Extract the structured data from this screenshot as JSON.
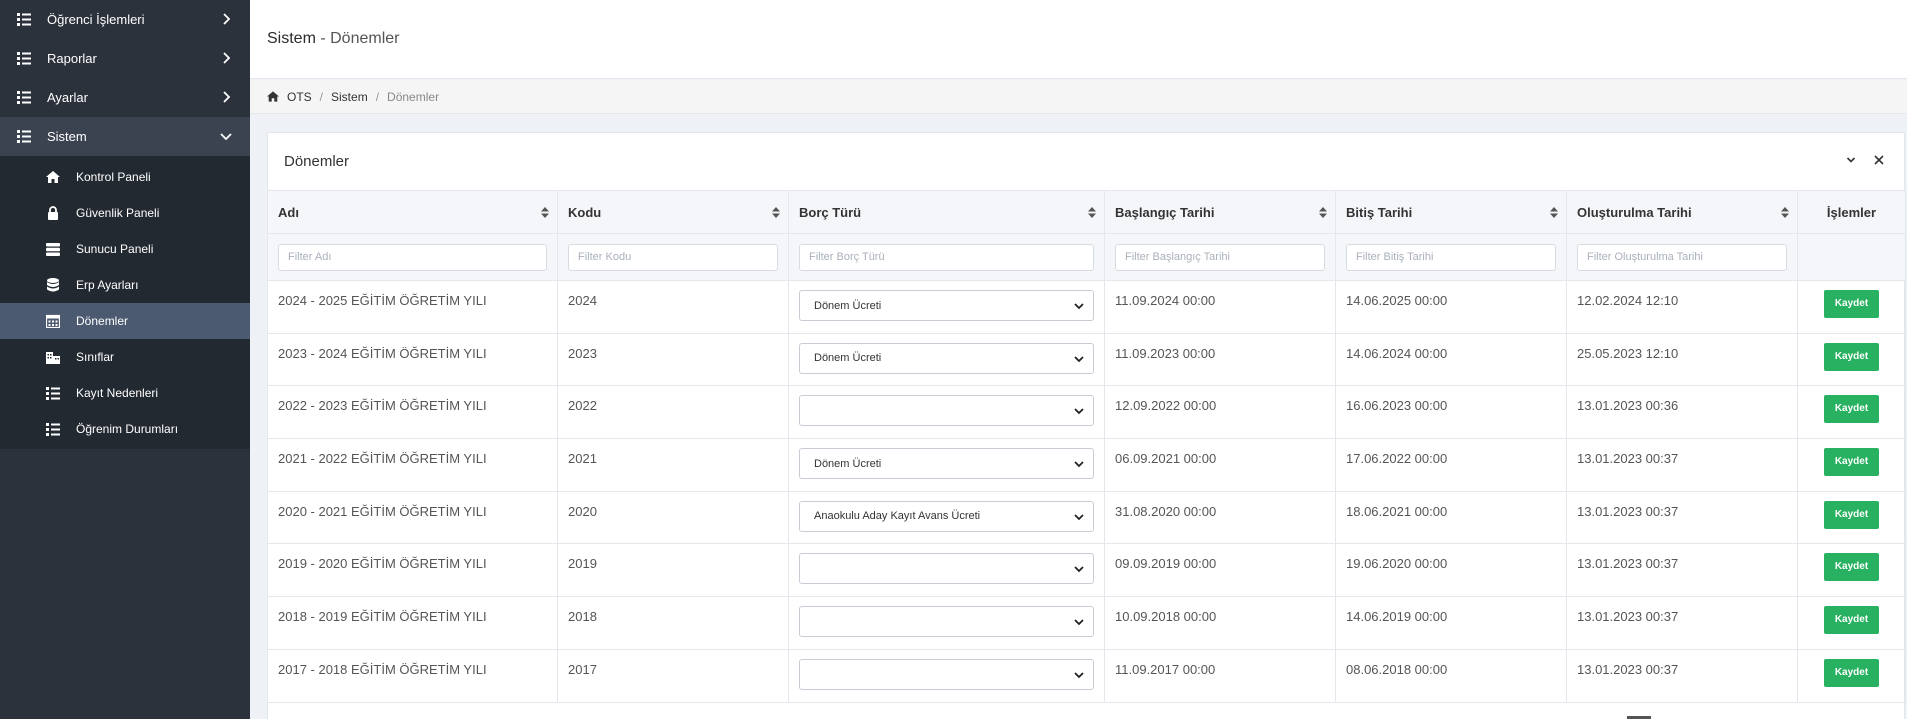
{
  "sidebar": {
    "items": [
      {
        "label": "Öğrenci İşlemleri",
        "icon": "list-icon"
      },
      {
        "label": "Raporlar",
        "icon": "list-icon"
      },
      {
        "label": "Ayarlar",
        "icon": "list-icon"
      },
      {
        "label": "Sistem",
        "icon": "list-icon",
        "expanded": true
      }
    ],
    "submenu": [
      {
        "label": "Kontrol Paneli",
        "icon": "home-icon"
      },
      {
        "label": "Güvenlik Paneli",
        "icon": "lock-icon"
      },
      {
        "label": "Sunucu Paneli",
        "icon": "server-icon"
      },
      {
        "label": "Erp Ayarları",
        "icon": "database-icon"
      },
      {
        "label": "Dönemler",
        "icon": "calendar-icon",
        "active": true
      },
      {
        "label": "Sınıflar",
        "icon": "building-icon"
      },
      {
        "label": "Kayıt Nedenleri",
        "icon": "list-icon"
      },
      {
        "label": "Öğrenim Durumları",
        "icon": "list-icon"
      }
    ]
  },
  "header": {
    "title_main": "Sistem",
    "title_sep": " - ",
    "title_sub": "Dönemler"
  },
  "breadcrumb": {
    "home": "OTS",
    "section": "Sistem",
    "current": "Dönemler",
    "separator": "/"
  },
  "portlet": {
    "title": "Dönemler"
  },
  "table": {
    "columns": [
      "Adı",
      "Kodu",
      "Borç Türü",
      "Başlangıç Tarihi",
      "Bitiş Tarihi",
      "Oluşturulma Tarihi",
      "İşlemler"
    ],
    "filters": [
      "Filter Adı",
      "Filter Kodu",
      "Filter Borç Türü",
      "Filter Başlangıç Tarihi",
      "Filter Bitiş Tarihi",
      "Filter Oluşturulma Tarihi"
    ],
    "action_label": "Kaydet",
    "rows": [
      {
        "name": "2024 - 2025 EĞİTİM ÖĞRETİM YILI",
        "code": "2024",
        "debt": "Dönem Ücreti",
        "start": "11.09.2024 00:00",
        "end": "14.06.2025 00:00",
        "created": "12.02.2024 12:10"
      },
      {
        "name": "2023 - 2024 EĞİTİM ÖĞRETİM YILI",
        "code": "2023",
        "debt": "Dönem Ücreti",
        "start": "11.09.2023 00:00",
        "end": "14.06.2024 00:00",
        "created": "25.05.2023 12:10"
      },
      {
        "name": "2022 - 2023 EĞİTİM ÖĞRETİM YILI",
        "code": "2022",
        "debt": "",
        "start": "12.09.2022 00:00",
        "end": "16.06.2023 00:00",
        "created": "13.01.2023 00:36"
      },
      {
        "name": "2021 - 2022 EĞİTİM ÖĞRETİM YILI",
        "code": "2021",
        "debt": "Dönem Ücreti",
        "start": "06.09.2021 00:00",
        "end": "17.06.2022 00:00",
        "created": "13.01.2023 00:37"
      },
      {
        "name": "2020 - 2021 EĞİTİM ÖĞRETİM YILI",
        "code": "2020",
        "debt": "Anaokulu Aday Kayıt Avans Ücreti",
        "start": "31.08.2020 00:00",
        "end": "18.06.2021 00:00",
        "created": "13.01.2023 00:37"
      },
      {
        "name": "2019 - 2020 EĞİTİM ÖĞRETİM YILI",
        "code": "2019",
        "debt": "",
        "start": "09.09.2019 00:00",
        "end": "19.06.2020 00:00",
        "created": "13.01.2023 00:37"
      },
      {
        "name": "2018 - 2019 EĞİTİM ÖĞRETİM YILI",
        "code": "2018",
        "debt": "",
        "start": "10.09.2018 00:00",
        "end": "14.06.2019 00:00",
        "created": "13.01.2023 00:37"
      },
      {
        "name": "2017 - 2018 EĞİTİM ÖĞRETİM YILI",
        "code": "2017",
        "debt": "",
        "start": "11.09.2017 00:00",
        "end": "08.06.2018 00:00",
        "created": "13.01.2023 00:37"
      }
    ]
  }
}
